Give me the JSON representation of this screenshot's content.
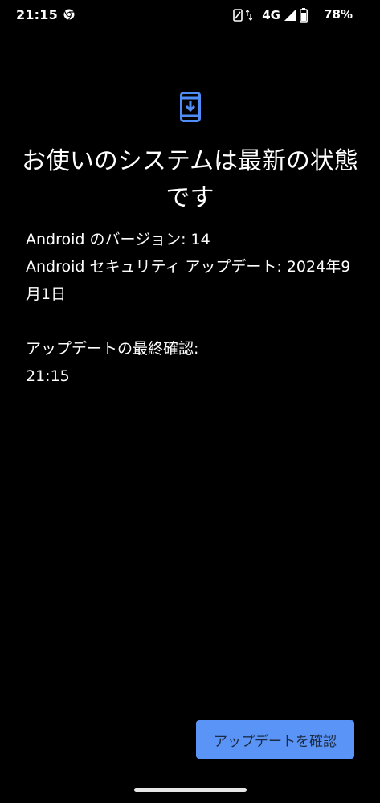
{
  "status_bar": {
    "time": "21:15",
    "network": "4G",
    "battery": "78%",
    "icons": [
      "chrome-icon",
      "vibrate-icon",
      "data-arrows-icon",
      "signal-icon",
      "battery-icon"
    ]
  },
  "main": {
    "icon": "system-update-icon",
    "title": "お使いのシステムは最新の状態です",
    "version_line": "Android のバージョン: 14",
    "security_line": "Android セキュリティ アップデート: 2024年9月1日",
    "last_check_label": "アップデートの最終確認:",
    "last_check_time": "21:15"
  },
  "actions": {
    "check_update_label": "アップデートを確認"
  },
  "colors": {
    "background": "#000000",
    "accent": "#4f8ef7",
    "button": "#5a94f6",
    "button_text": "#1c2b44"
  }
}
